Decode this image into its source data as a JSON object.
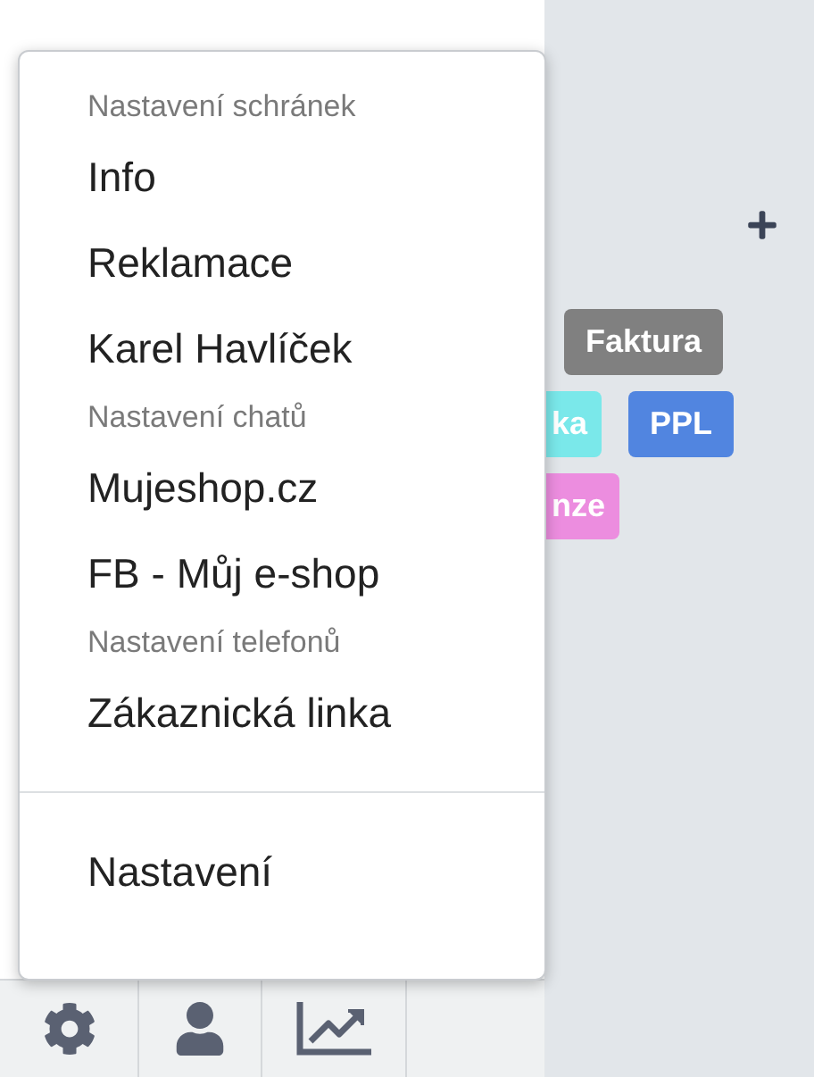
{
  "menu": {
    "sections": [
      {
        "header": "Nastavení schránek",
        "items": [
          "Info",
          "Reklamace",
          "Karel Havlíček"
        ]
      },
      {
        "header": "Nastavení chatů",
        "items": [
          "Mujeshop.cz",
          "FB - Můj e-shop"
        ]
      },
      {
        "header": "Nastavení telefonů",
        "items": [
          "Zákaznická linka"
        ]
      }
    ],
    "footer_item": "Nastavení"
  },
  "tag_rows": [
    [
      {
        "label": "Faktura",
        "color": "#808080",
        "cut": false
      }
    ],
    [
      {
        "label": "ka",
        "color": "#7ae8ea",
        "cut": true
      },
      {
        "label": "PPL",
        "color": "#5185e0",
        "cut": false
      }
    ],
    [
      {
        "label": "nze",
        "color": "#ec8ddf",
        "cut": true
      }
    ]
  ]
}
